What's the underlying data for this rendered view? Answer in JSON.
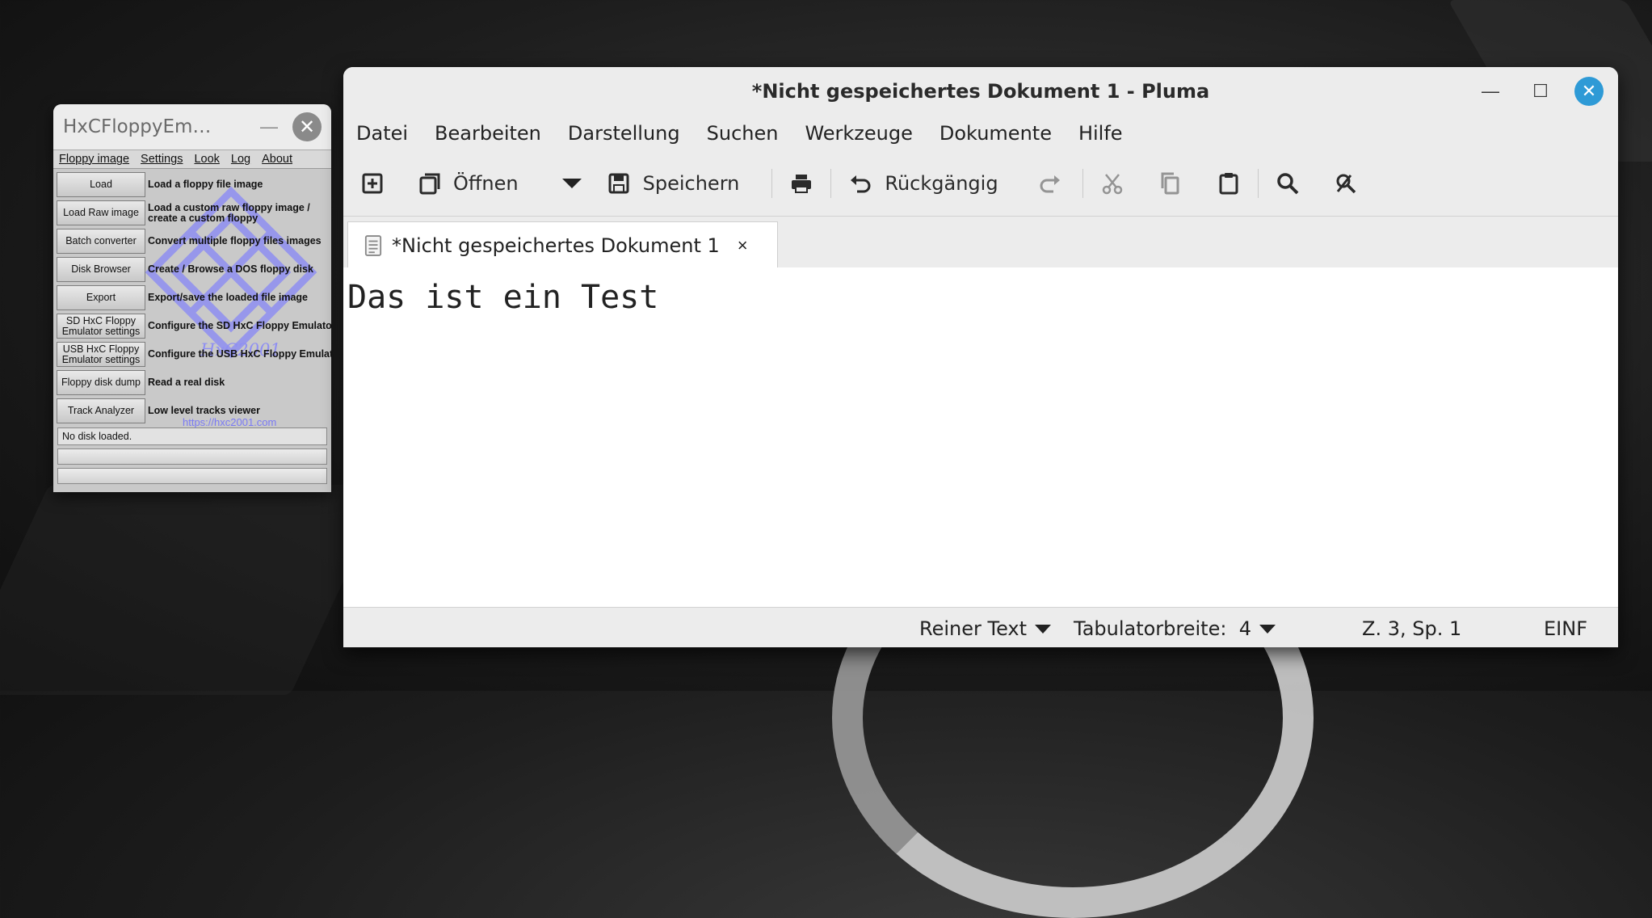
{
  "hxc": {
    "title": "HxCFloppyEm…",
    "min_glyph": "—",
    "close_glyph": "✕",
    "menu": [
      "Floppy image",
      "Settings",
      "Look",
      "Log",
      "About"
    ],
    "rows": [
      {
        "button": "Load",
        "desc": "Load a floppy file image"
      },
      {
        "button": "Load Raw image",
        "desc": "Load a custom raw floppy image /\ncreate a custom floppy"
      },
      {
        "button": "Batch converter",
        "desc": "Convert multiple floppy files images"
      },
      {
        "button": "Disk Browser",
        "desc": "Create / Browse a DOS floppy disk"
      },
      {
        "button": "Export",
        "desc": "Export/save the loaded file image"
      },
      {
        "button": "SD HxC Floppy\nEmulator settings",
        "desc": "Configure the SD HxC Floppy Emulator"
      },
      {
        "button": "USB HxC Floppy\nEmulator settings",
        "desc": "Configure the USB HxC Floppy Emulator"
      },
      {
        "button": "Floppy disk dump",
        "desc": "Read a real disk"
      },
      {
        "button": "Track Analyzer",
        "desc": "Low level tracks viewer"
      }
    ],
    "logo_text": "HxC2001",
    "url": "https://hxc2001.com",
    "status": "No disk loaded."
  },
  "pluma": {
    "title": "*Nicht gespeichertes Dokument 1 - Pluma",
    "menu": [
      "Datei",
      "Bearbeiten",
      "Darstellung",
      "Suchen",
      "Werkzeuge",
      "Dokumente",
      "Hilfe"
    ],
    "toolbar": {
      "open_label": "Öffnen",
      "save_label": "Speichern",
      "undo_label": "Rückgängig"
    },
    "tab": {
      "label": "*Nicht gespeichertes Dokument 1",
      "close_glyph": "×"
    },
    "content": "Das ist ein Test",
    "status": {
      "language": "Reiner Text",
      "tab_width": "Tabulatorbreite:  4",
      "position": "Z. 3, Sp. 1",
      "mode": "EINF"
    },
    "window_controls": {
      "minimize": "—",
      "maximize": "☐",
      "close": "✕"
    }
  },
  "colors": {
    "accent_close": "#2e9ad6",
    "hxc_logo": "#7a7af5"
  }
}
